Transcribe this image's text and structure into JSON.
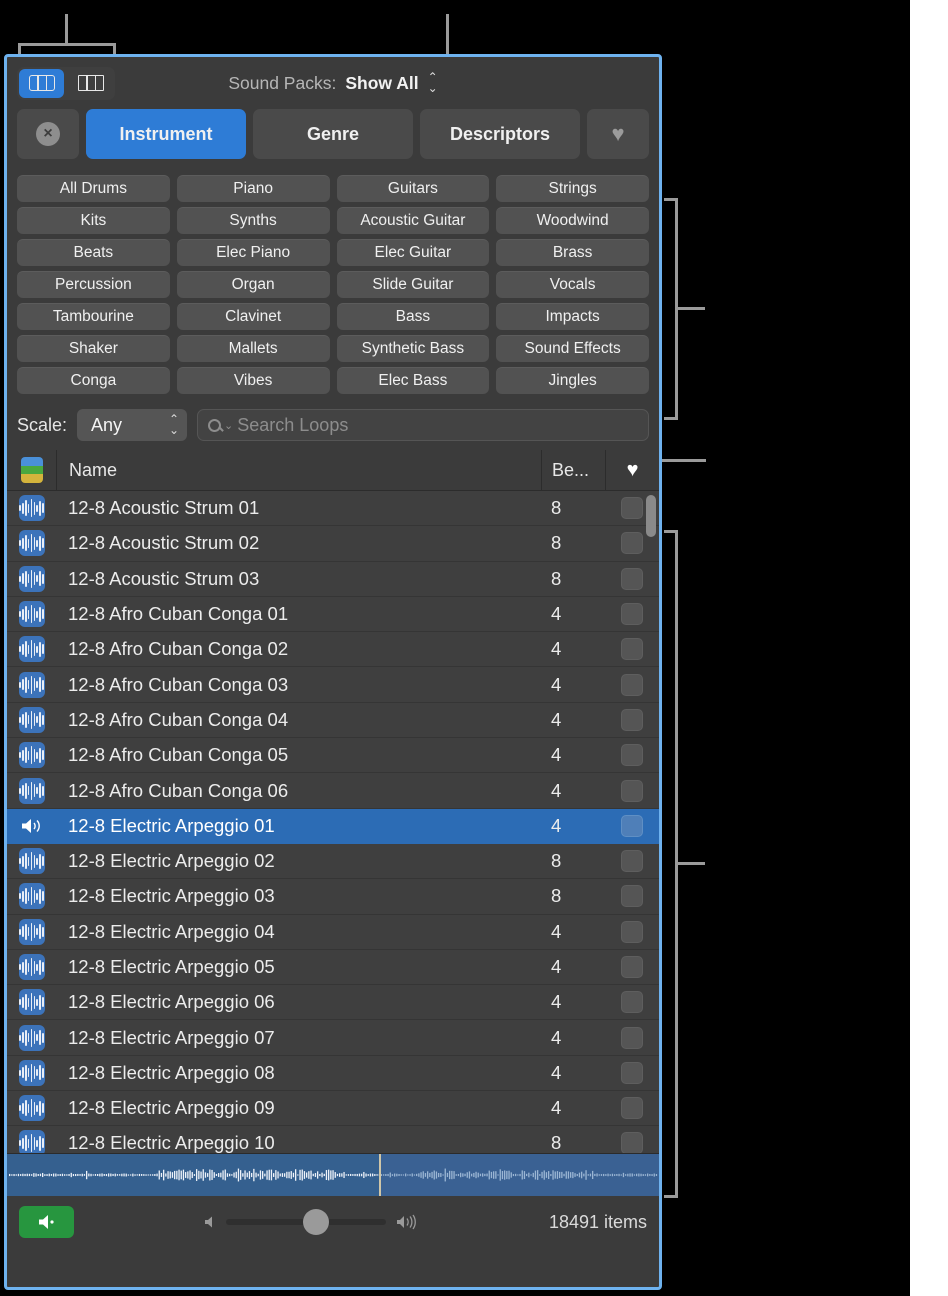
{
  "window": {
    "accent_border": "#6eb2ef",
    "background": "#3b3b3b"
  },
  "toolbar": {
    "view_modes": [
      {
        "name": "grid-view",
        "label": "Grid View",
        "active": true
      },
      {
        "name": "column-view",
        "label": "Column View",
        "active": false
      }
    ],
    "sound_packs_label": "Sound Packs:",
    "sound_packs_value": "Show All"
  },
  "filters": {
    "clear_label": "×",
    "buttons": [
      {
        "label": "Instrument",
        "active": true
      },
      {
        "label": "Genre",
        "active": false
      },
      {
        "label": "Descriptors",
        "active": false
      }
    ],
    "favorites_glyph": "♥"
  },
  "categories": [
    "All Drums",
    "Piano",
    "Guitars",
    "Strings",
    "Kits",
    "Synths",
    "Acoustic Guitar",
    "Woodwind",
    "Beats",
    "Elec Piano",
    "Elec Guitar",
    "Brass",
    "Percussion",
    "Organ",
    "Slide Guitar",
    "Vocals",
    "Tambourine",
    "Clavinet",
    "Bass",
    "Impacts",
    "Shaker",
    "Mallets",
    "Synthetic Bass",
    "Sound Effects",
    "Conga",
    "Vibes",
    "Elec Bass",
    "Jingles"
  ],
  "search": {
    "scale_label": "Scale:",
    "scale_value": "Any",
    "placeholder": "Search Loops"
  },
  "table": {
    "columns": {
      "icon": "loop-type-icon",
      "name": "Name",
      "beats": "Be...",
      "favorite": "♥"
    },
    "rows": [
      {
        "name": "12-8 Acoustic Strum 01",
        "beats": "8",
        "selected": false,
        "favorite": false
      },
      {
        "name": "12-8 Acoustic Strum 02",
        "beats": "8",
        "selected": false,
        "favorite": false
      },
      {
        "name": "12-8 Acoustic Strum 03",
        "beats": "8",
        "selected": false,
        "favorite": false
      },
      {
        "name": "12-8 Afro Cuban Conga 01",
        "beats": "4",
        "selected": false,
        "favorite": false
      },
      {
        "name": "12-8 Afro Cuban Conga 02",
        "beats": "4",
        "selected": false,
        "favorite": false
      },
      {
        "name": "12-8 Afro Cuban Conga 03",
        "beats": "4",
        "selected": false,
        "favorite": false
      },
      {
        "name": "12-8 Afro Cuban Conga 04",
        "beats": "4",
        "selected": false,
        "favorite": false
      },
      {
        "name": "12-8 Afro Cuban Conga 05",
        "beats": "4",
        "selected": false,
        "favorite": false
      },
      {
        "name": "12-8 Afro Cuban Conga 06",
        "beats": "4",
        "selected": false,
        "favorite": false
      },
      {
        "name": "12-8 Electric Arpeggio 01",
        "beats": "4",
        "selected": true,
        "favorite": false
      },
      {
        "name": "12-8 Electric Arpeggio 02",
        "beats": "8",
        "selected": false,
        "favorite": false
      },
      {
        "name": "12-8 Electric Arpeggio 03",
        "beats": "8",
        "selected": false,
        "favorite": false
      },
      {
        "name": "12-8 Electric Arpeggio 04",
        "beats": "4",
        "selected": false,
        "favorite": false
      },
      {
        "name": "12-8 Electric Arpeggio 05",
        "beats": "4",
        "selected": false,
        "favorite": false
      },
      {
        "name": "12-8 Electric Arpeggio 06",
        "beats": "4",
        "selected": false,
        "favorite": false
      },
      {
        "name": "12-8 Electric Arpeggio 07",
        "beats": "4",
        "selected": false,
        "favorite": false
      },
      {
        "name": "12-8 Electric Arpeggio 08",
        "beats": "4",
        "selected": false,
        "favorite": false
      },
      {
        "name": "12-8 Electric Arpeggio 09",
        "beats": "4",
        "selected": false,
        "favorite": false
      },
      {
        "name": "12-8 Electric Arpeggio 10",
        "beats": "8",
        "selected": false,
        "favorite": false
      }
    ]
  },
  "preview": {
    "playhead_percent": 57
  },
  "footer": {
    "play_label": "▶",
    "volume_percent": 56,
    "item_count": "18491 items"
  },
  "colors": {
    "accent_blue": "#2e7cd6",
    "selection_blue": "#2c6cb5",
    "loop_icon_blue": "#3c73ba",
    "play_green": "#27963f",
    "stripe_blue": "#4a90d9",
    "stripe_green": "#4aa83f",
    "stripe_yellow": "#d4b43c"
  }
}
